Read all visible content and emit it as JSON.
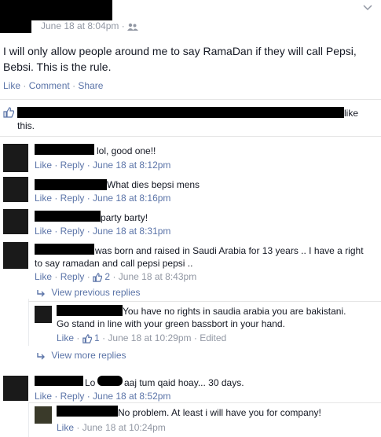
{
  "post": {
    "timestamp": "June 18 at 8:04pm",
    "audience_separator": "·",
    "body": "I will only allow people around me to say RamaDan if they will call Pepsi, Bebsi. This is the rule.",
    "actions": {
      "like": "Like",
      "comment": "Comment",
      "share": "Share",
      "sep": "·"
    }
  },
  "likes": {
    "text_end": "like",
    "text_line2": "this."
  },
  "comments": [
    {
      "text": "lol, good one!!",
      "actions": "Like · Reply · June 18 at 8:12pm"
    },
    {
      "text": "What dies bepsi mens",
      "actions": "Like · Reply · June 18 at 8:16pm"
    },
    {
      "text": "party barty!",
      "actions": "Like · Reply · June 18 at 8:31pm"
    },
    {
      "text_line1": "was born and raised in Saudi Arabia for 13 years .. I have a right",
      "text_line2": "to say ramadan and call pepsi pepsi ..",
      "like": "Like",
      "reply": "Reply",
      "likes_count": "2",
      "time": "June 18 at 8:43pm"
    },
    {
      "text": "aaj tum qaid hoay... 30 days.",
      "name_fragment": "Lo",
      "actions": "Like · Reply · June 18 at 8:52pm"
    }
  ],
  "view_previous": "View previous replies",
  "view_more": "View more replies",
  "reply1": {
    "text_line1": "You have no rights in saudia arabia you are bakistani.",
    "text_line2": "Go stand in line with your green bassbort in your hand.",
    "like": "Like",
    "likes_count": "1",
    "time": "June 18 at 10:29pm",
    "edited": "Edited"
  },
  "reply2": {
    "text": "No problem. At least i will have you for company!",
    "like": "Like",
    "time": "June 18 at 10:24pm"
  },
  "colors": {
    "link": "#5b74a8",
    "meta": "#9197a3",
    "text": "#141823"
  }
}
